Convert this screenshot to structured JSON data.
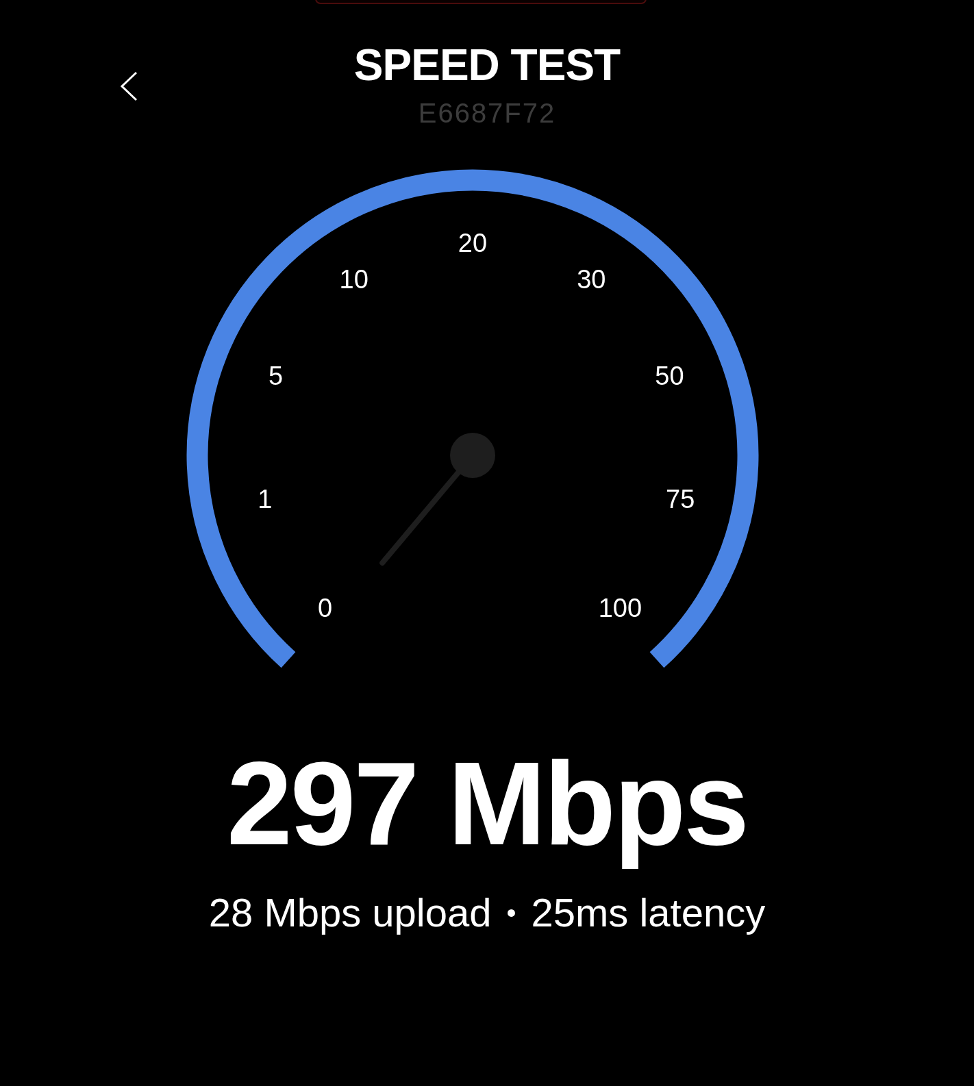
{
  "header": {
    "title": "SPEED TEST",
    "device_id": "E6687F72"
  },
  "gauge": {
    "scale_labels": [
      "0",
      "1",
      "5",
      "10",
      "20",
      "30",
      "50",
      "75",
      "100"
    ]
  },
  "result": {
    "download": "297 Mbps",
    "upload": "28 Mbps upload",
    "separator": "•",
    "latency": "25ms latency"
  }
}
